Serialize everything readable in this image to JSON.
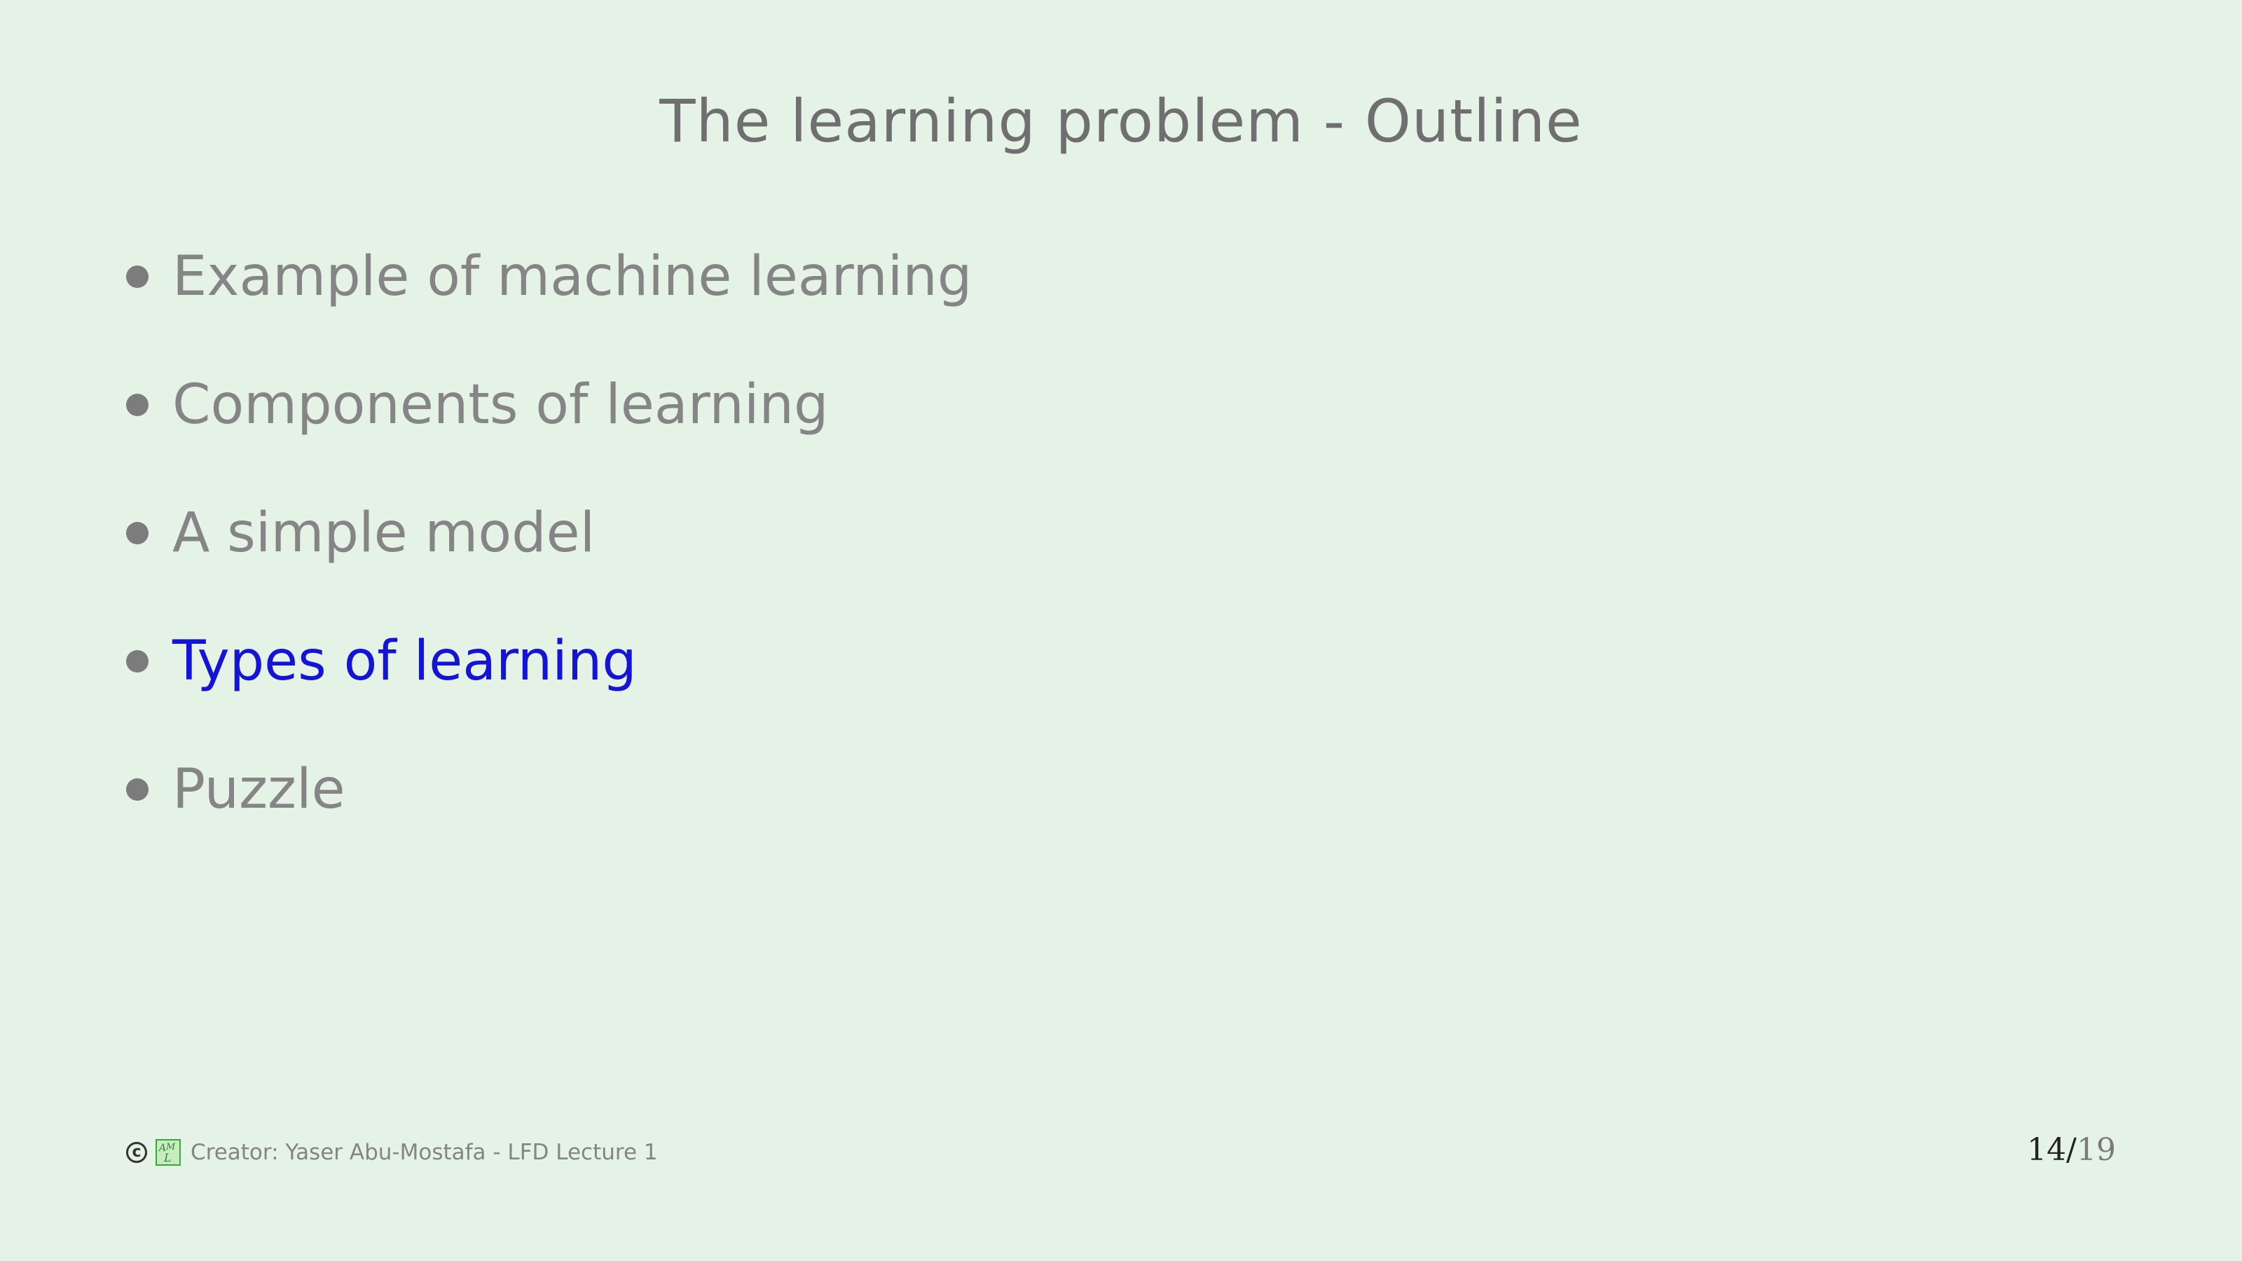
{
  "slide": {
    "title": "The learning problem - Outline",
    "outline": [
      {
        "label": "Example of machine learning",
        "current": false
      },
      {
        "label": "Components of learning",
        "current": false
      },
      {
        "label": "A simple model",
        "current": false
      },
      {
        "label": "Types of learning",
        "current": true
      },
      {
        "label": "Puzzle",
        "current": false
      }
    ],
    "colors": {
      "background": "#e5f3e6",
      "current_item": "#1414d6",
      "normal_item": "#858585"
    }
  },
  "footer": {
    "copyright_symbol": "c",
    "logo": "AML-logo-icon",
    "creator": "Creator: Yaser Abu-Mostafa - LFD Lecture 1"
  },
  "page": {
    "current": "14",
    "separator": "/",
    "total": "19"
  }
}
